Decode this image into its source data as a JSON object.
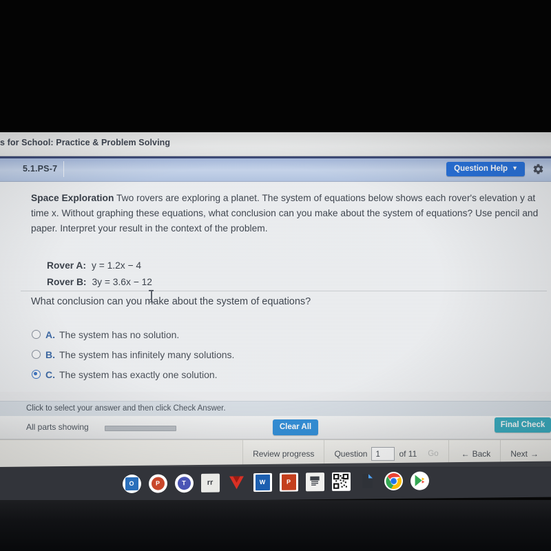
{
  "browser": {
    "title": "s for School: Practice & Problem Solving"
  },
  "exercise": {
    "id": "5.1.PS-7",
    "question_help_label": "Question Help",
    "question_help_caret": "▼",
    "gear_icon": "gear-icon"
  },
  "question": {
    "lead": "Space Exploration",
    "text": "Two rovers are exploring a planet. The system of equations below shows each rover's elevation y at time x. Without graphing these equations, what conclusion can you make about the system of equations? Use pencil and paper. Interpret your result in the context of the problem.",
    "equations": [
      {
        "label": "Rover A:",
        "expression": "y = 1.2x − 4"
      },
      {
        "label": "Rover B:",
        "expression": "3y = 3.6x − 12"
      }
    ],
    "sub_question": "What conclusion can you make about the system of equations?"
  },
  "choices": [
    {
      "key": "A.",
      "label": "The system has no solution.",
      "selected": false
    },
    {
      "key": "B.",
      "label": "The system has infinitely many solutions.",
      "selected": false
    },
    {
      "key": "C.",
      "label": "The system has exactly one solution.",
      "selected": true
    }
  ],
  "instruction": {
    "text": "Click to select your answer and then click Check Answer."
  },
  "actions": {
    "all_parts_label": "All parts showing",
    "clear_all_label": "Clear All",
    "final_check_label": "Final Check"
  },
  "navigation": {
    "review_progress_label": "Review progress",
    "question_label": "Question",
    "question_value": "1",
    "of_label": "of 11",
    "go_label": "Go",
    "back_label": "Back",
    "back_arrow": "←",
    "next_label": "Next",
    "next_arrow": "→"
  },
  "taskbar": {
    "items": [
      {
        "name": "microsoft-outlook-icon",
        "glyph": "O",
        "bg": "#2a6fbb",
        "style": "round"
      },
      {
        "name": "microsoft-powerpoint-round-icon",
        "glyph": "P",
        "bg": "#c8472b",
        "style": "round"
      },
      {
        "name": "microsoft-teams-icon",
        "glyph": "T",
        "bg": "#4a55b5",
        "style": "round"
      },
      {
        "name": "notes-document-icon",
        "glyph": "rr",
        "bg": "#e9e9e6",
        "style": "square-light"
      },
      {
        "name": "red-check-v-icon",
        "glyph": "V",
        "bg": "#d93025",
        "style": "flat-red"
      },
      {
        "name": "microsoft-word-icon",
        "glyph": "W",
        "bg": "#1c5fb0",
        "style": "square"
      },
      {
        "name": "microsoft-powerpoint-icon",
        "glyph": "P",
        "bg": "#c43e1c",
        "style": "square"
      },
      {
        "name": "schoology-doc-icon",
        "glyph": "",
        "bg": "#f0f0ee",
        "style": "square-light"
      },
      {
        "name": "qr-code-icon",
        "glyph": "",
        "bg": "#ffffff",
        "style": "square-light"
      },
      {
        "name": "files-app-icon",
        "glyph": "",
        "bg": "#2d3036",
        "style": "file"
      },
      {
        "name": "google-chrome-icon",
        "glyph": "",
        "bg": "#ffffff",
        "style": "chrome",
        "active": true
      },
      {
        "name": "google-play-store-icon",
        "glyph": "",
        "bg": "#ffffff",
        "style": "play"
      }
    ]
  },
  "colors": {
    "accent_blue": "#1565d8",
    "clear_all_blue": "#2186d6",
    "final_check_teal": "#2aa8bd",
    "header_band": "#c3d2ea",
    "selected_radio": "#2f6bbf"
  }
}
